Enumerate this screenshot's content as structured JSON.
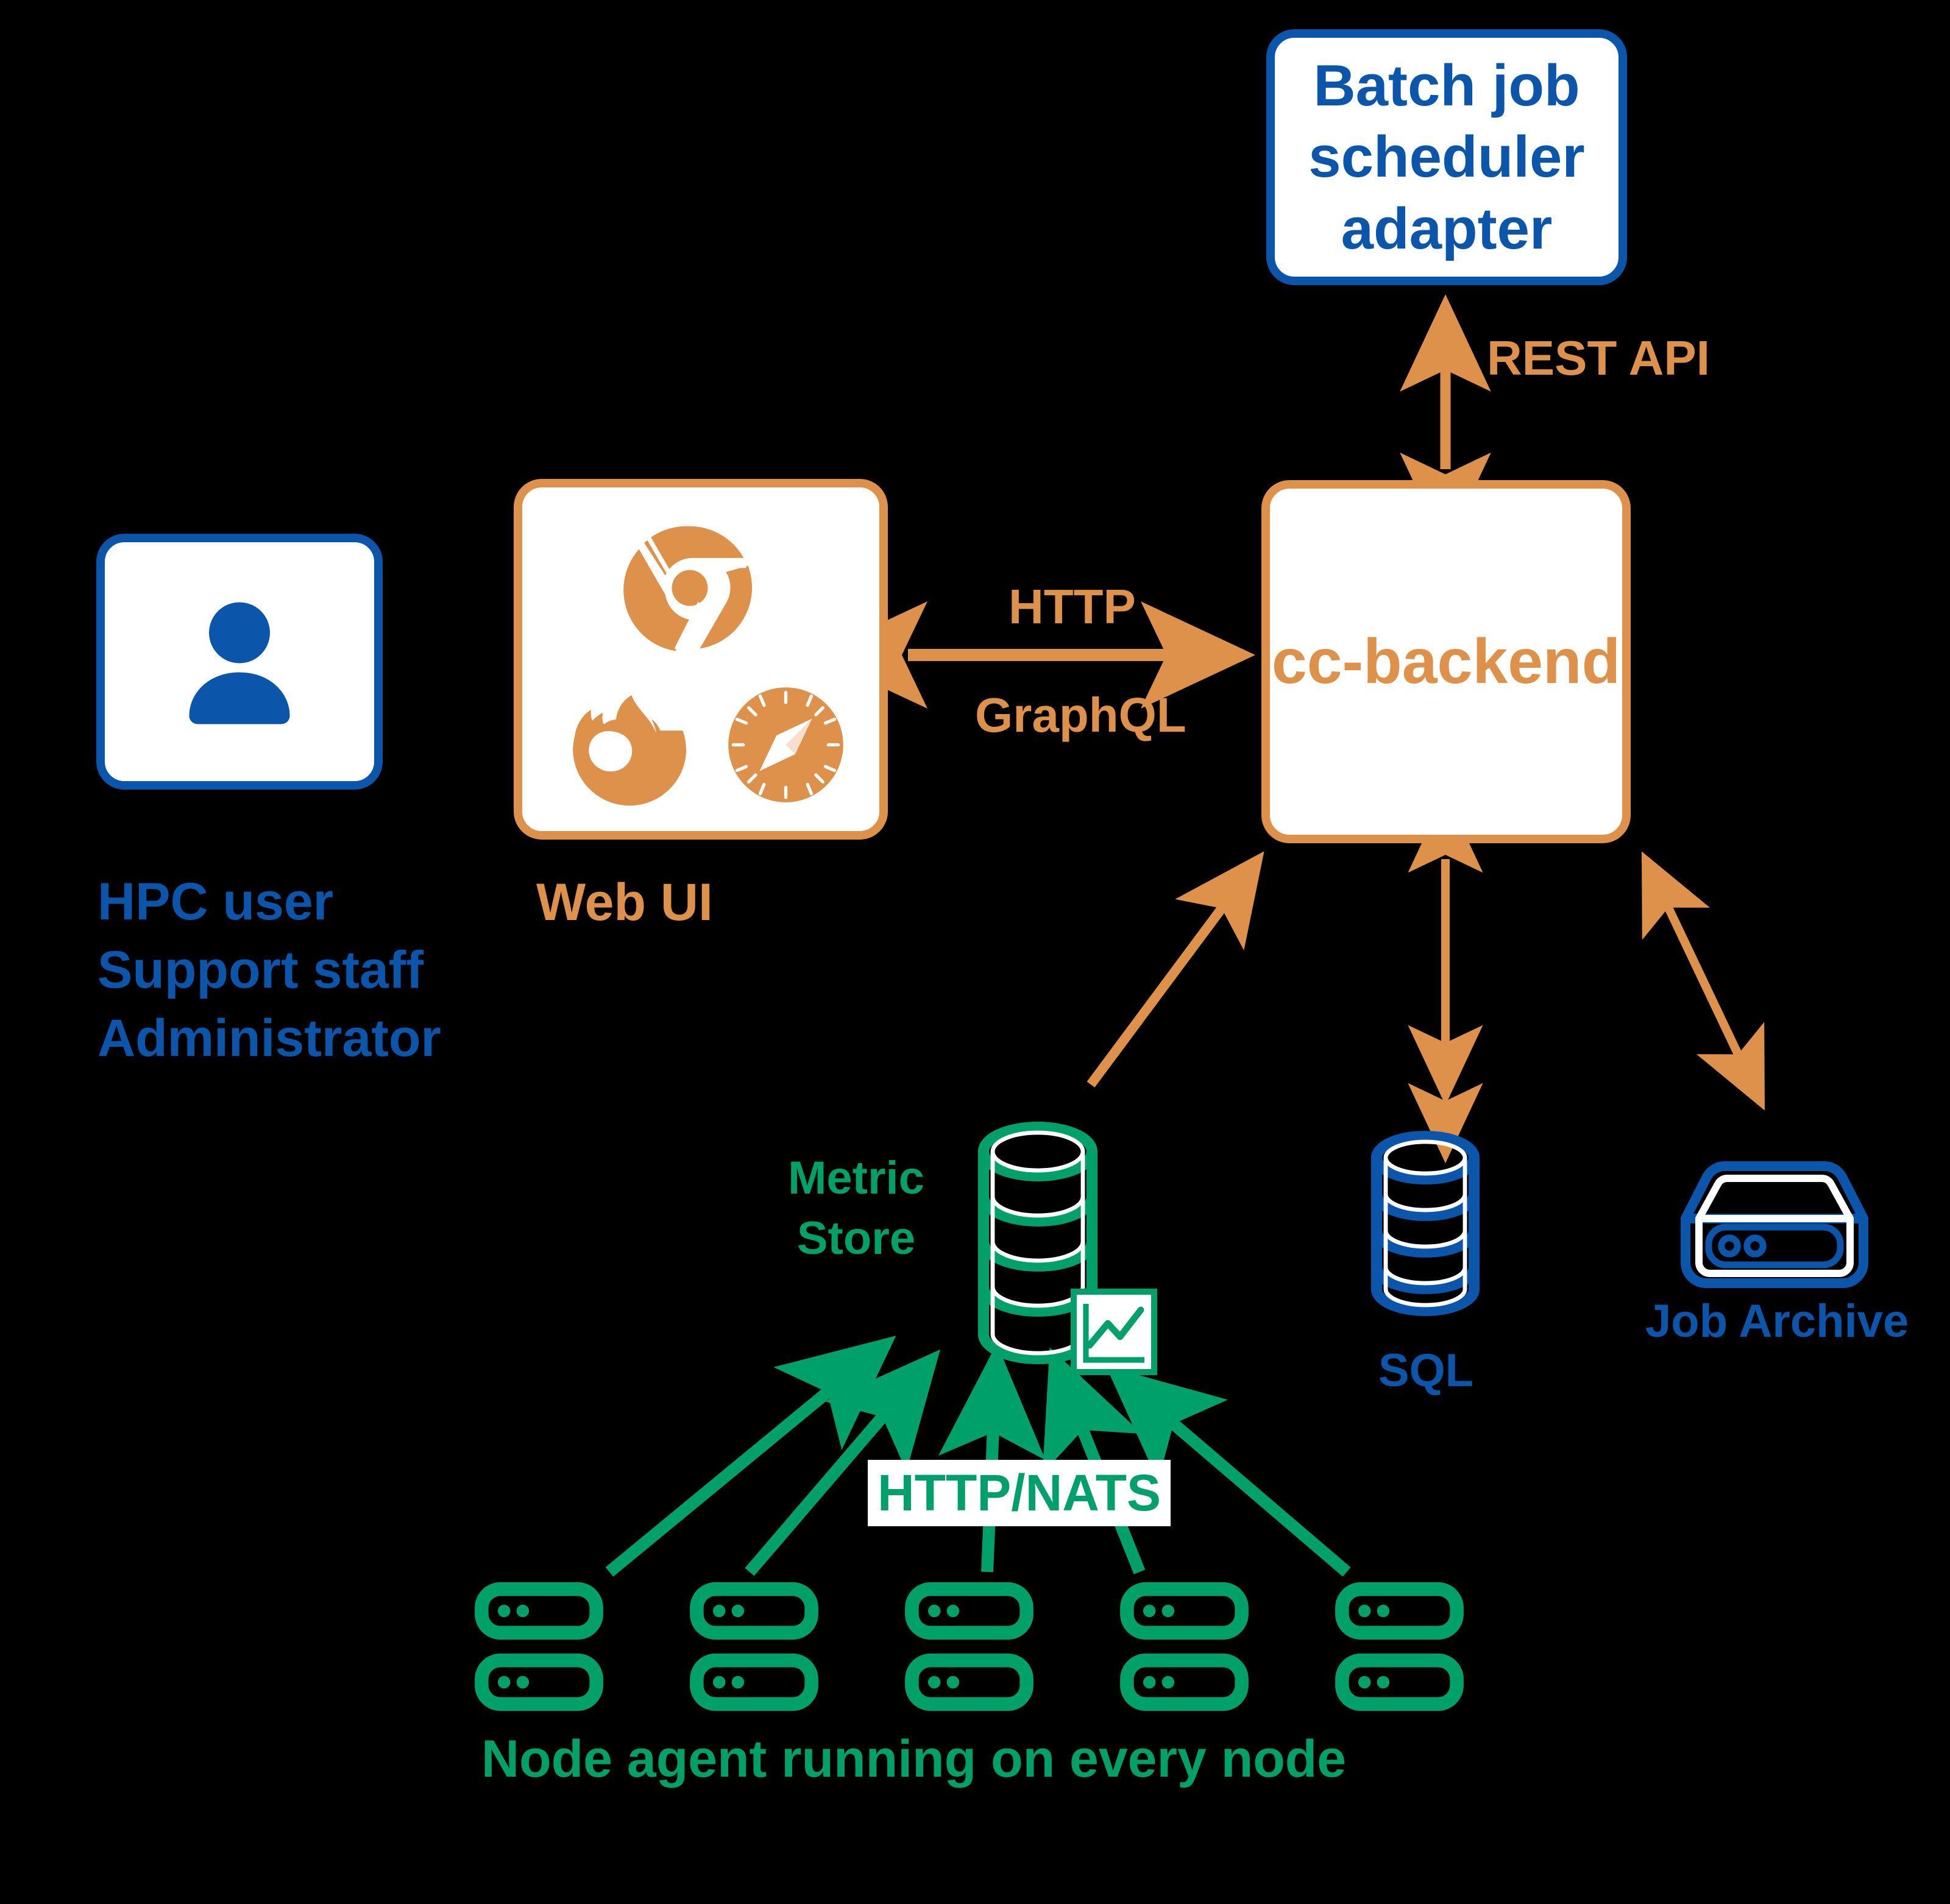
{
  "diagram": {
    "title": "ClusterCockpit architecture overview",
    "background": "#000000",
    "colors": {
      "blue": "#0B55AA",
      "orange": "#DD914A",
      "green": "#00A06A",
      "white": "#FFFFFF"
    }
  },
  "nodes": {
    "batch_scheduler": {
      "label": "Batch job\nscheduler\nadapter",
      "color": "#0B55AA",
      "shape": "rounded-rect"
    },
    "hpc_user": {
      "icon": "person-icon",
      "roles": "HPC user\nSupport staff\nAdministrator",
      "color": "#0B55AA"
    },
    "web_ui": {
      "caption": "Web UI",
      "color": "#DD914A",
      "browsers": [
        "chrome-icon",
        "firefox-icon",
        "safari-icon"
      ]
    },
    "cc_backend": {
      "label": "cc-backend",
      "color": "#DD914A"
    },
    "metric_store": {
      "caption": "Metric\nStore",
      "icon": "database-cylinder-icon",
      "badge": "line-chart-icon",
      "color": "#00A06A"
    },
    "sql": {
      "caption": "SQL",
      "icon": "database-cylinder-icon",
      "color": "#0B55AA"
    },
    "job_archive": {
      "caption": "Job Archive",
      "icon": "hard-drive-icon",
      "color": "#0B55AA"
    },
    "node_agents": {
      "caption": "Node agent running on every node",
      "icon": "server-node-icon",
      "columns": 5,
      "rows": 2,
      "color": "#00A06A"
    }
  },
  "edges": [
    {
      "id": "rest-api",
      "from": "cc_backend",
      "to": "batch_scheduler",
      "label": "REST\nAPI",
      "color": "#DD914A",
      "direction": "both"
    },
    {
      "id": "http-graphql",
      "from": "web_ui",
      "to": "cc_backend",
      "label_top": "HTTP",
      "label_bottom": "GraphQL",
      "color": "#DD914A",
      "direction": "both"
    },
    {
      "id": "metric-link",
      "from": "metric_store",
      "to": "cc_backend",
      "label": "",
      "color": "#DD914A",
      "direction": "up"
    },
    {
      "id": "sql-link",
      "from": "cc_backend",
      "to": "sql",
      "label": "",
      "color": "#DD914A",
      "direction": "both"
    },
    {
      "id": "archive-link",
      "from": "cc_backend",
      "to": "job_archive",
      "label": "",
      "color": "#DD914A",
      "direction": "both"
    },
    {
      "id": "agents-link",
      "from": "node_agents",
      "to": "metric_store",
      "label": "HTTP/NATS",
      "color": "#00A06A",
      "direction": "up"
    }
  ],
  "labels": {
    "rest_api": "REST\nAPI",
    "http": "HTTP",
    "graphql": "GraphQL",
    "http_nats": "HTTP/NATS"
  }
}
